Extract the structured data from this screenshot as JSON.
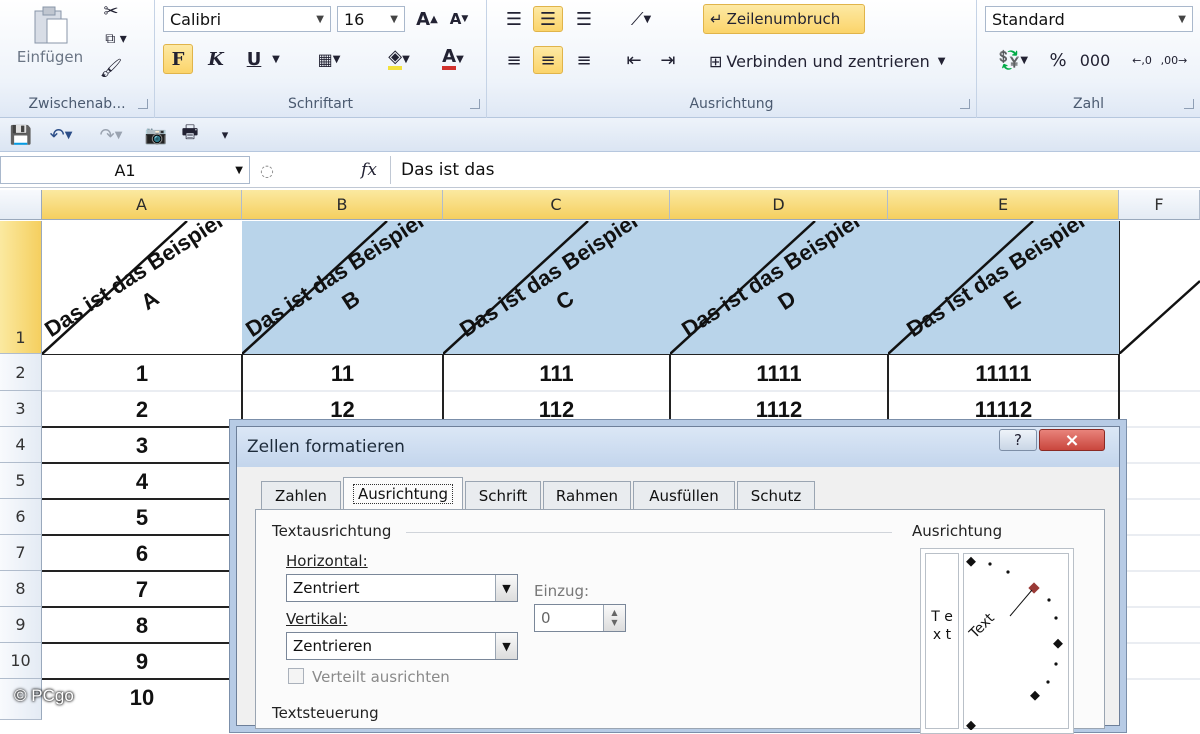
{
  "ribbon": {
    "clipboard": {
      "paste_label": "Einfügen",
      "group_label": "Zwischenab..."
    },
    "font": {
      "font_name": "Calibri",
      "font_size": "16",
      "bold_label": "F",
      "italic_label": "K",
      "underline_label": "U",
      "group_label": "Schriftart"
    },
    "alignment": {
      "wrap_label": "Zeilenumbruch",
      "merge_label": "Verbinden und zentrieren",
      "group_label": "Ausrichtung"
    },
    "number": {
      "format": "Standard",
      "percent": "%",
      "thousands": "000",
      "group_label": "Zahl"
    }
  },
  "formula_bar": {
    "name_box": "A1",
    "fx": "fx",
    "content": "Das ist das"
  },
  "columns": [
    "A",
    "B",
    "C",
    "D",
    "E",
    "F"
  ],
  "rows": [
    "1",
    "2",
    "3",
    "4",
    "5",
    "6",
    "7",
    "8",
    "9",
    "10"
  ],
  "header_cells": [
    "Das ist das Beispiel A",
    "Das ist das Beispiel B",
    "Das ist das Beispiel C",
    "Das ist das Beispiel D",
    "Das ist das Beispiel E"
  ],
  "data": {
    "A": [
      "1",
      "2",
      "3",
      "4",
      "5",
      "6",
      "7",
      "8",
      "9",
      "10"
    ],
    "B": [
      "11",
      "12"
    ],
    "C": [
      "111",
      "112"
    ],
    "D": [
      "1111",
      "1112"
    ],
    "E": [
      "11111",
      "11112"
    ]
  },
  "dialog": {
    "title": "Zellen formatieren",
    "help": "?",
    "close": "×",
    "tabs": [
      "Zahlen",
      "Ausrichtung",
      "Schrift",
      "Rahmen",
      "Ausfüllen",
      "Schutz"
    ],
    "section_text_alignment": "Textausrichtung",
    "horizontal_label": "Horizontal:",
    "horizontal_value": "Zentriert",
    "vertical_label": "Vertikal:",
    "vertical_value": "Zentrieren",
    "indent_label": "Einzug:",
    "indent_value": "0",
    "distributed_label": "Verteilt ausrichten",
    "section_text_control": "Textsteuerung",
    "orientation_label": "Ausrichtung",
    "vertical_text": "T e x t",
    "dial_text": "Text"
  },
  "watermark": "© PCgo",
  "colors": {
    "selection": "#f5cf5f",
    "header_fill": "#b9d4ea",
    "dialog_close": "#c9463d"
  }
}
